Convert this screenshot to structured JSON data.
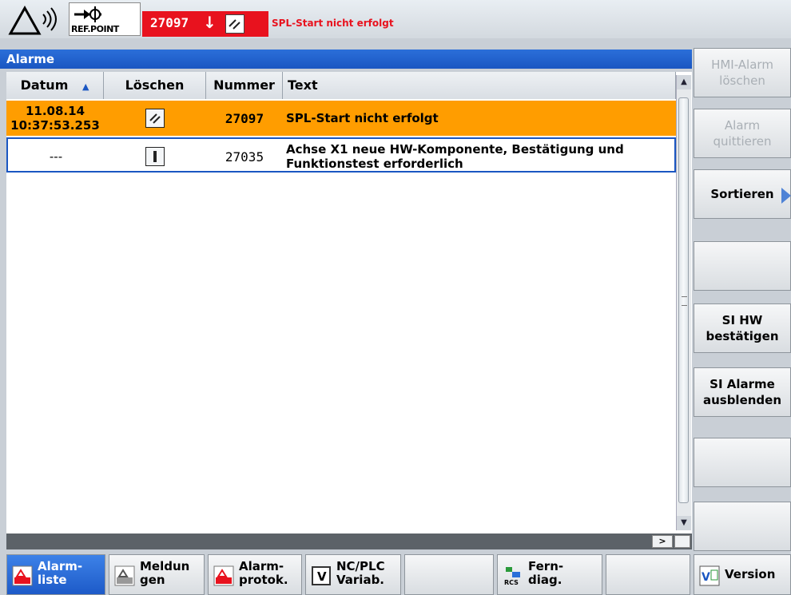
{
  "header": {
    "ref_label": "REF.POINT",
    "alarm_number": "27097",
    "alarm_arrow": "↓",
    "alarm_text": "SPL-Start nicht erfolgt",
    "alarm_color": "#e8121e"
  },
  "title": "Alarme",
  "table": {
    "columns": [
      "Datum",
      "Löschen",
      "Nummer",
      "Text"
    ],
    "sort_indicator": "▲",
    "rows": [
      {
        "date": "11.08.14",
        "time": "10:37:53.253",
        "ack_icon": "power-on-reset-icon",
        "number": "27097",
        "text": "SPL-Start nicht erfolgt",
        "selected": true
      },
      {
        "date": "---",
        "time": "",
        "ack_icon": "cancel-key-icon",
        "number": "27035",
        "text": "Achse X1 neue HW-Komponente, Bestätigung und Funktionstest erforderlich",
        "selected": false
      }
    ]
  },
  "right_softkeys": [
    {
      "label": "HMI-Alarm löschen",
      "enabled": false
    },
    {
      "label": "Alarm quittieren",
      "enabled": false
    },
    {
      "label": "Sortieren",
      "enabled": true
    },
    {
      "label": "",
      "enabled": true
    },
    {
      "label": "SI HW bestätigen",
      "enabled": true
    },
    {
      "label": "SI Alarme ausblenden",
      "enabled": true
    },
    {
      "label": "",
      "enabled": true
    },
    {
      "label": "",
      "enabled": true
    }
  ],
  "bottom_softkeys": [
    {
      "label": "Alarm-\nliste",
      "active": true
    },
    {
      "label": "Meldun\ngen",
      "active": false
    },
    {
      "label": "Alarm-\nprotok.",
      "active": false
    },
    {
      "label": "NC/PLC\nVariab.",
      "active": false
    },
    {
      "label": "",
      "active": false
    },
    {
      "label": "Fern-\ndiag.",
      "active": false
    },
    {
      "label": "",
      "active": false
    },
    {
      "label": "Version",
      "active": false
    }
  ],
  "colors": {
    "selected_row": "#ff9d00",
    "title_bar": "#1a56c2"
  }
}
